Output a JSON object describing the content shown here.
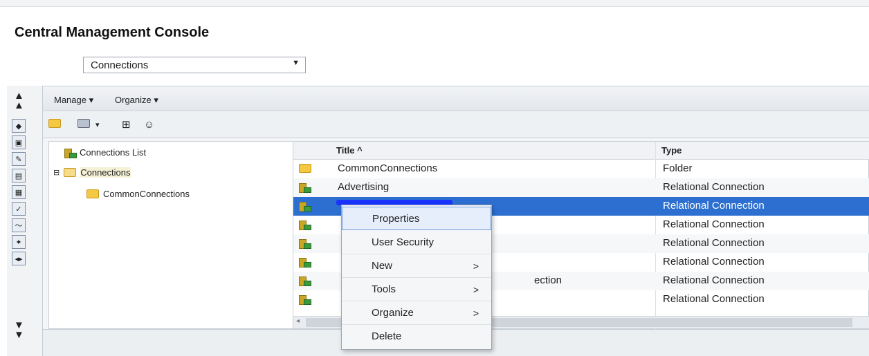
{
  "app": {
    "title": "Central Management Console"
  },
  "nav_dropdown": {
    "value": "Connections"
  },
  "toolbar": {
    "manage": "Manage",
    "organize": "Organize"
  },
  "tree": {
    "items": [
      {
        "label": "Connections List"
      },
      {
        "label": "Connections"
      },
      {
        "label": "CommonConnections"
      }
    ]
  },
  "grid": {
    "columns": {
      "title": "Title",
      "sort_indicator": "^",
      "type": "Type"
    },
    "rows": [
      {
        "title": "CommonConnections",
        "type": "Folder",
        "icon": "folder-icon"
      },
      {
        "title": "Advertising",
        "type": "Relational Connection",
        "icon": "connection-icon"
      },
      {
        "title": "",
        "type": "Relational Connection",
        "icon": "connection-icon",
        "selected": true
      },
      {
        "title": "",
        "type": "Relational Connection",
        "icon": "connection-icon"
      },
      {
        "title": "",
        "type": "Relational Connection",
        "icon": "connection-icon"
      },
      {
        "title": "",
        "type": "Relational Connection",
        "icon": "connection-icon"
      },
      {
        "title": "ection",
        "type": "Relational Connection",
        "icon": "connection-icon"
      },
      {
        "title": "",
        "type": "Relational Connection",
        "icon": "connection-icon"
      }
    ]
  },
  "context_menu": {
    "items": [
      {
        "label": "Properties",
        "submenu": false
      },
      {
        "label": "User Security",
        "submenu": false
      },
      {
        "label": "New",
        "submenu": true
      },
      {
        "label": "Tools",
        "submenu": true
      },
      {
        "label": "Organize",
        "submenu": true
      },
      {
        "label": "Delete",
        "submenu": false
      }
    ],
    "submenu_glyph": ">"
  },
  "colors": {
    "selection": "#2d6fd0",
    "accent": "#1a33ff"
  }
}
